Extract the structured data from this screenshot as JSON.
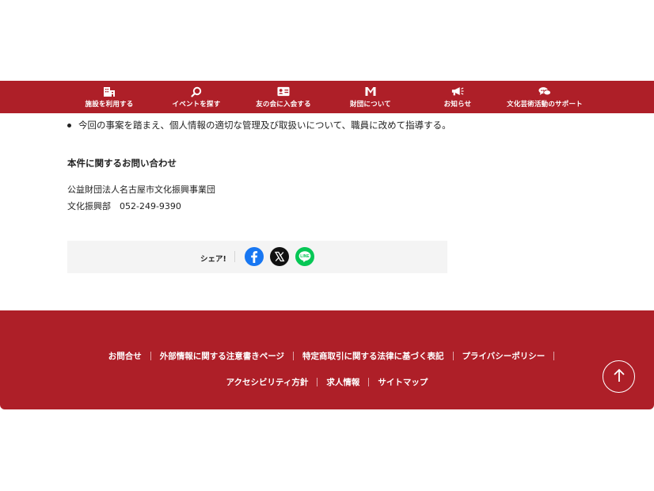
{
  "nav": {
    "items": [
      {
        "label": "施設を利用する",
        "icon": "building-icon"
      },
      {
        "label": "イベントを探す",
        "icon": "search-icon"
      },
      {
        "label": "友の会に入会する",
        "icon": "member-card-icon"
      },
      {
        "label": "財団について",
        "icon": "foundation-logo-icon"
      },
      {
        "label": "お知らせ",
        "icon": "megaphone-icon"
      },
      {
        "label": "文化芸術活動のサポート",
        "icon": "chat-bubbles-icon"
      }
    ]
  },
  "content": {
    "bullet_text": "今回の事案を踏まえ、個人情報の適切な管理及び取扱いについて、職員に改めて指導する。",
    "contact_heading": "本件に関するお問い合わせ",
    "contact_org": "公益財団法人名古屋市文化振興事業団",
    "contact_dept": "文化振興部　052-249-9390"
  },
  "share": {
    "label": "シェア!",
    "icons": [
      "facebook-icon",
      "x-icon",
      "line-icon"
    ],
    "line_text": "LINE"
  },
  "footer": {
    "row1": [
      "お問合せ",
      "外部情報に関する注意書きページ",
      "特定商取引に関する法律に基づく表記",
      "プライバシーポリシー"
    ],
    "row2": [
      "アクセシビリティ方針",
      "求人情報",
      "サイトマップ"
    ],
    "back_to_top_icon": "arrow-up-icon"
  },
  "colors": {
    "brand_red": "#ae1f28",
    "share_bg": "#f4f4f4",
    "facebook": "#1877f2",
    "x": "#111111",
    "line": "#06c755"
  }
}
